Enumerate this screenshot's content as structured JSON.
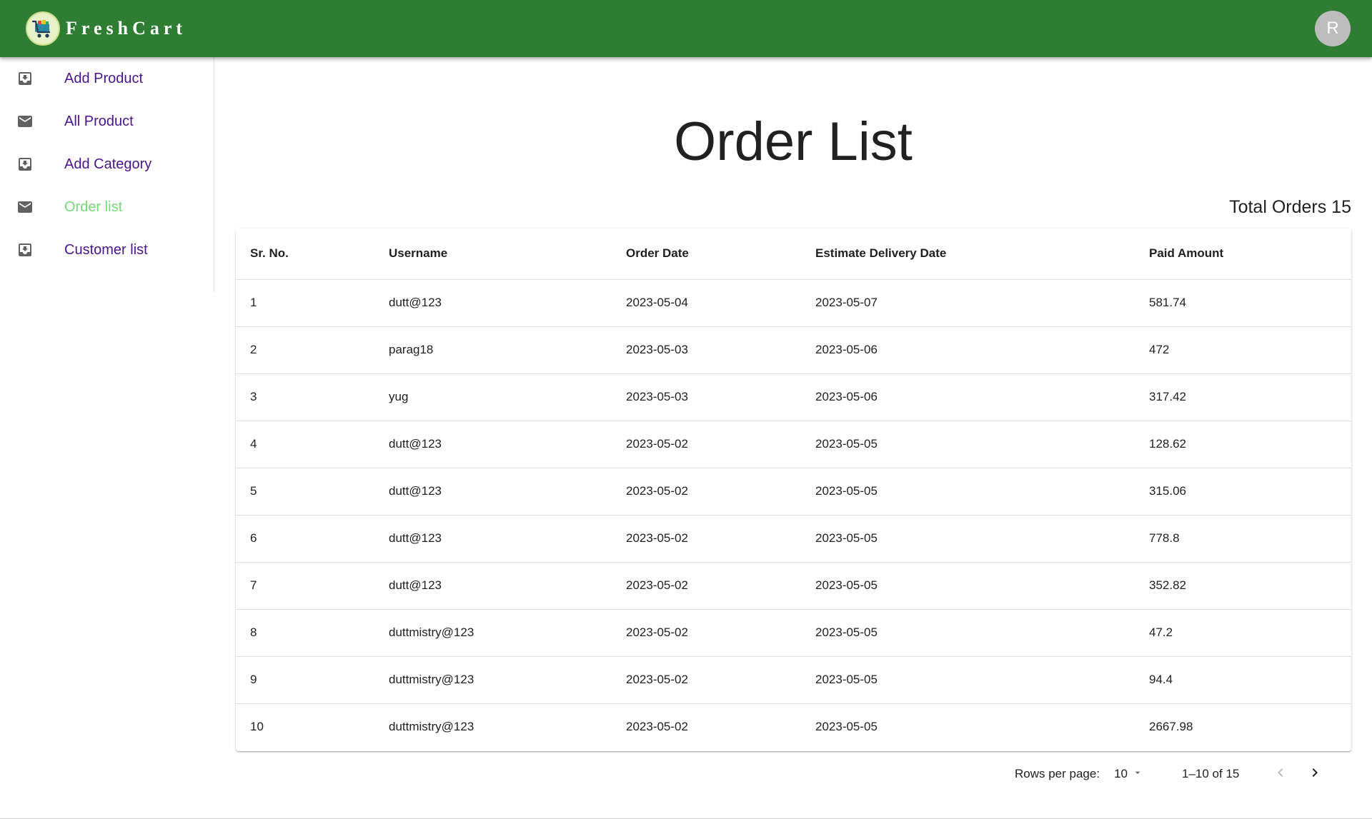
{
  "app": {
    "brand": "FreshCart",
    "avatar_initial": "R",
    "colors": {
      "appbar": "#2e7d32",
      "nav_text": "#4a148c",
      "nav_active": "#7ad67a"
    }
  },
  "sidebar": {
    "items": [
      {
        "label": "Add Product",
        "icon": "move-to-inbox-icon",
        "active": false
      },
      {
        "label": "All Product",
        "icon": "mail-icon",
        "active": false
      },
      {
        "label": "Add Category",
        "icon": "move-to-inbox-icon",
        "active": false
      },
      {
        "label": "Order list",
        "icon": "mail-icon",
        "active": true
      },
      {
        "label": "Customer list",
        "icon": "move-to-inbox-icon",
        "active": false
      }
    ]
  },
  "main": {
    "title": "Order List",
    "total_orders": "Total Orders 15"
  },
  "table": {
    "headers": [
      "Sr. No.",
      "Username",
      "Order Date",
      "Estimate Delivery Date",
      "Paid Amount"
    ],
    "rows": [
      [
        "1",
        "dutt@123",
        "2023-05-04",
        "2023-05-07",
        "581.74"
      ],
      [
        "2",
        "parag18",
        "2023-05-03",
        "2023-05-06",
        "472"
      ],
      [
        "3",
        "yug",
        "2023-05-03",
        "2023-05-06",
        "317.42"
      ],
      [
        "4",
        "dutt@123",
        "2023-05-02",
        "2023-05-05",
        "128.62"
      ],
      [
        "5",
        "dutt@123",
        "2023-05-02",
        "2023-05-05",
        "315.06"
      ],
      [
        "6",
        "dutt@123",
        "2023-05-02",
        "2023-05-05",
        "778.8"
      ],
      [
        "7",
        "dutt@123",
        "2023-05-02",
        "2023-05-05",
        "352.82"
      ],
      [
        "8",
        "duttmistry@123",
        "2023-05-02",
        "2023-05-05",
        "47.2"
      ],
      [
        "9",
        "duttmistry@123",
        "2023-05-02",
        "2023-05-05",
        "94.4"
      ],
      [
        "10",
        "duttmistry@123",
        "2023-05-02",
        "2023-05-05",
        "2667.98"
      ]
    ]
  },
  "pagination": {
    "rows_per_page_label": "Rows per page:",
    "rows_per_page_value": "10",
    "range_label": "1–10 of 15"
  }
}
